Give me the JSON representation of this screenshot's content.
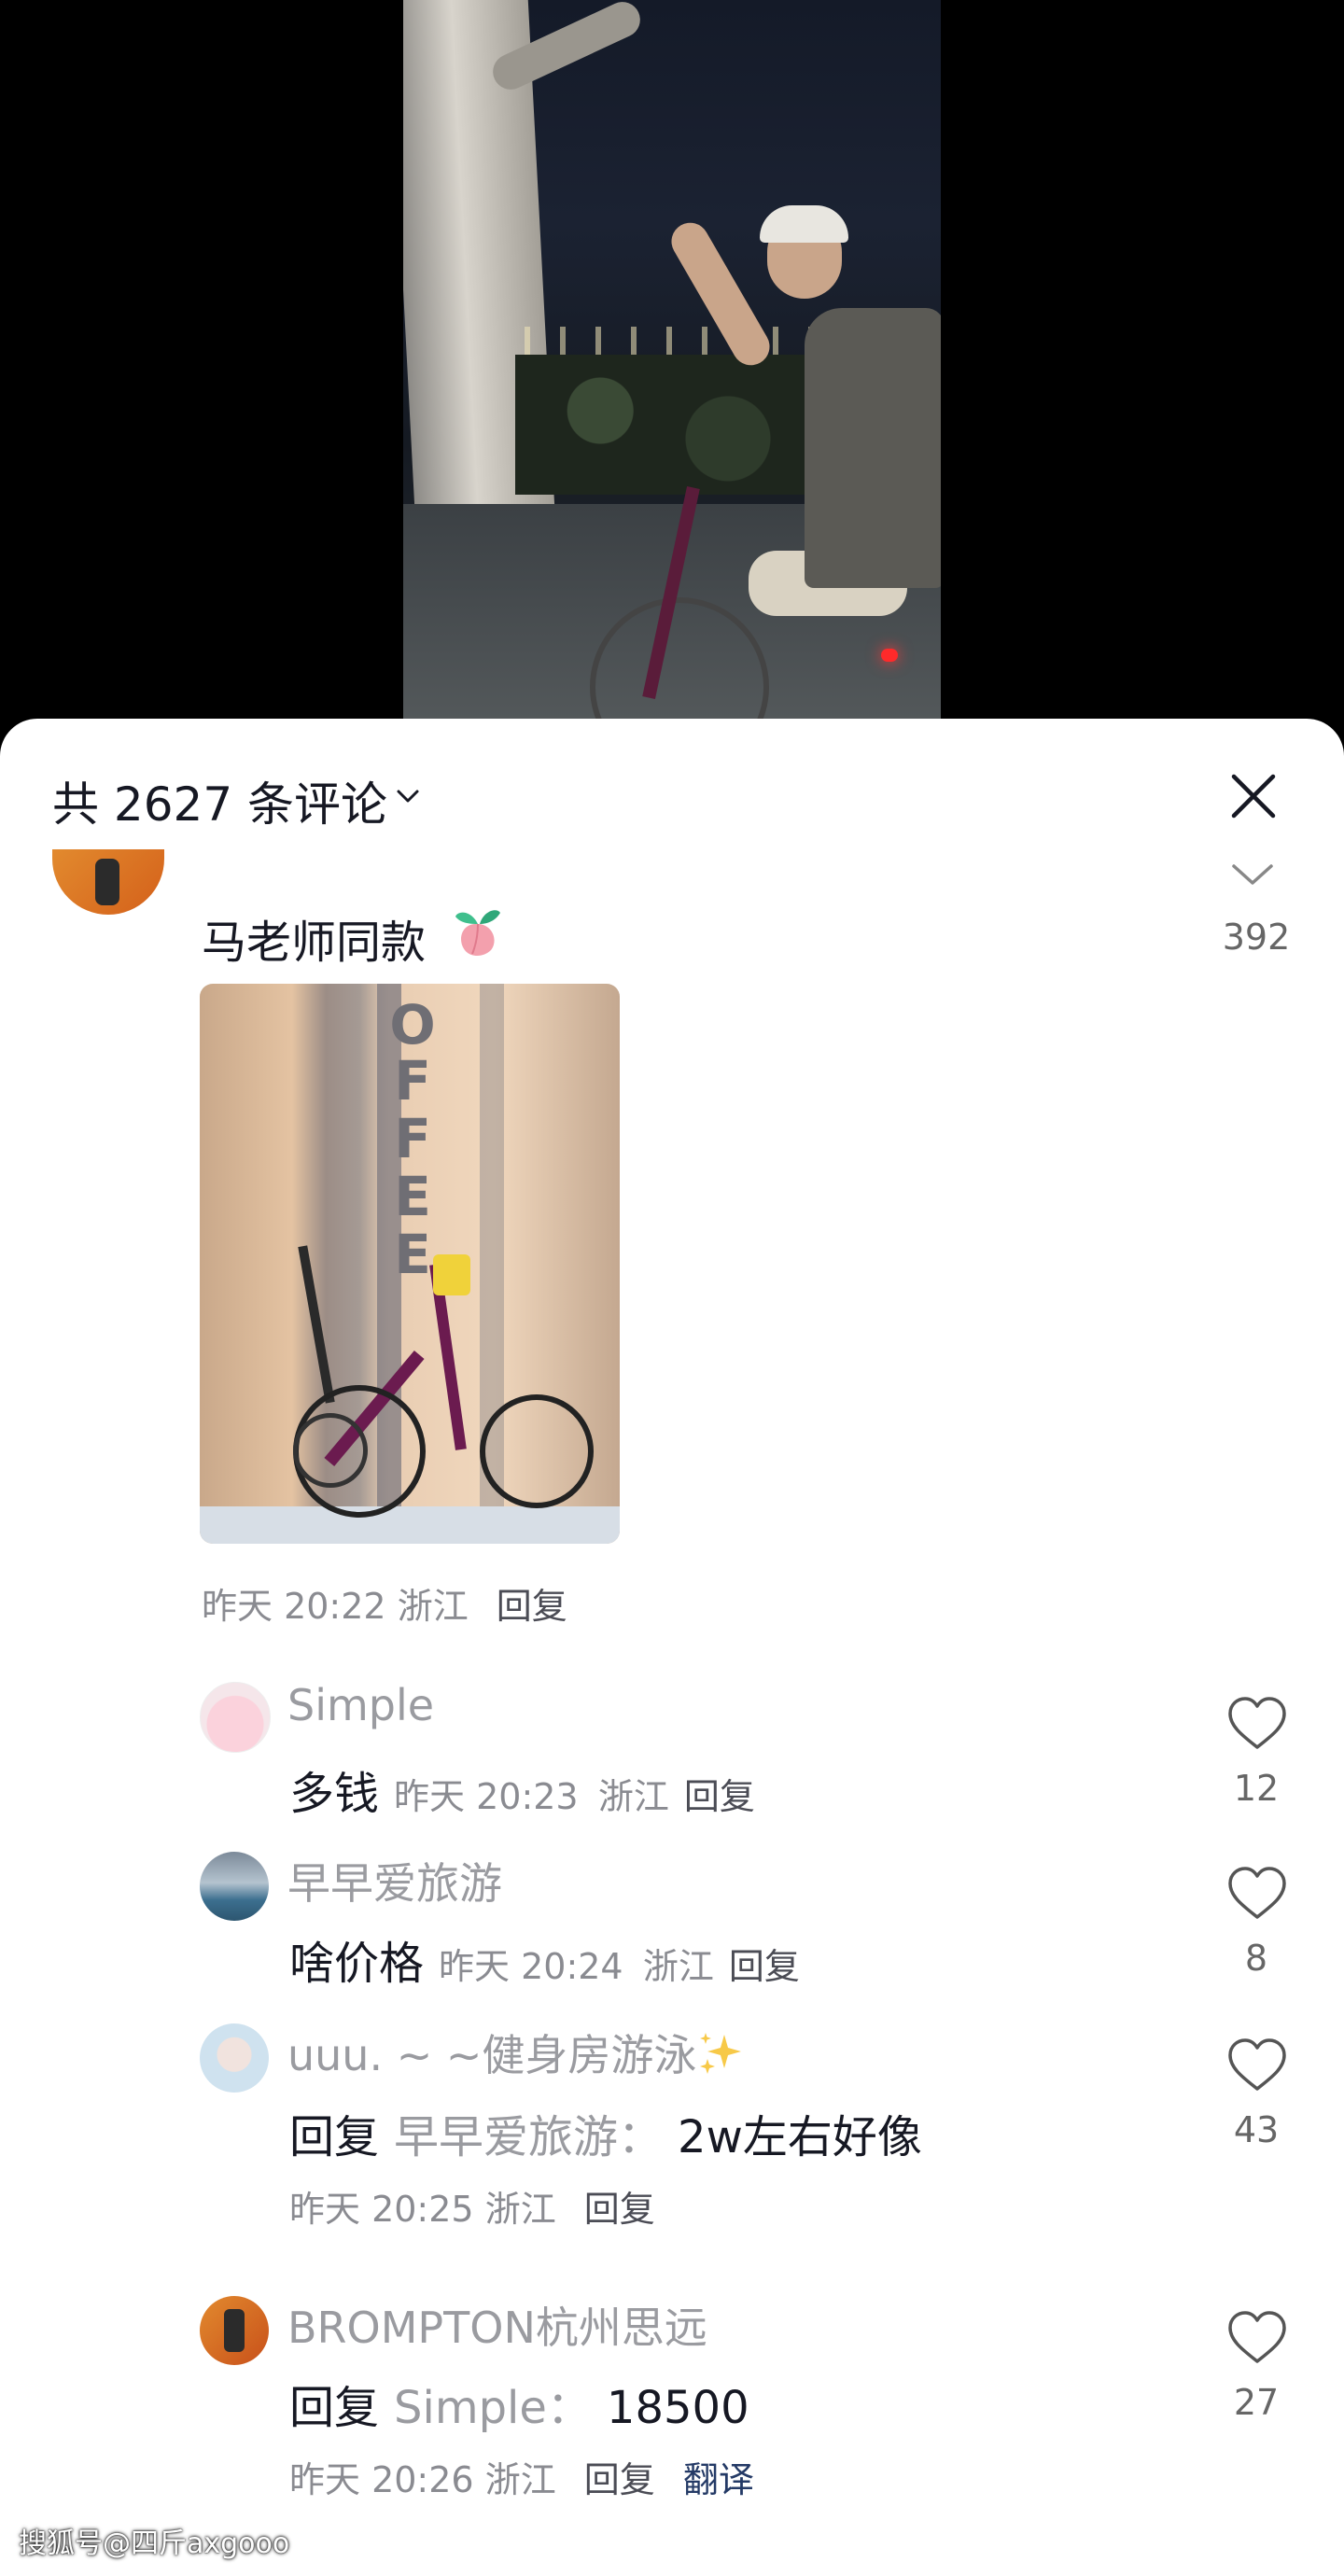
{
  "header": {
    "comment_count_label": "共 2627 条评论"
  },
  "main_comment": {
    "text": "马老师同款",
    "photo_letters": [
      "O",
      "F",
      "F",
      "E",
      "E"
    ],
    "time": "昨天 20:22",
    "location": "浙江",
    "reply_label": "回复",
    "collapsed_count": "392"
  },
  "replies": [
    {
      "name": "Simple",
      "text": "多钱",
      "time": "昨天 20:23",
      "location": "浙江",
      "reply_label": "回复",
      "likes": "12"
    },
    {
      "name": "早早爱旅游",
      "text": "啥价格",
      "time": "昨天 20:24",
      "location": "浙江",
      "reply_label": "回复",
      "likes": "8"
    },
    {
      "name": "uuu. ~ ~健身房游泳",
      "reply_prefix": "回复",
      "reply_to": "早早爱旅游：",
      "text": "2w左右好像",
      "time": "昨天 20:25",
      "location": "浙江",
      "reply_label": "回复",
      "likes": "43"
    },
    {
      "name": "BROMPTON杭州思远",
      "reply_prefix": "回复",
      "reply_to": "Simple：",
      "text": "18500",
      "time": "昨天 20:26",
      "location": "浙江",
      "reply_label": "回复",
      "translate_label": "翻译",
      "likes": "27"
    }
  ],
  "watermark": "搜狐号@四斤axgooo",
  "icons": {
    "count_chevron": "chevron-down-icon",
    "close": "close-icon",
    "collapse": "chevron-down-icon",
    "like": "heart-outline-icon",
    "peach": "peach-emoji-icon",
    "sparkles": "sparkles-emoji-icon"
  },
  "colors": {
    "text_primary": "#161823",
    "text_secondary": "#8a8b91",
    "name_gray": "#9a9ba0",
    "translate_blue": "#243a66"
  }
}
